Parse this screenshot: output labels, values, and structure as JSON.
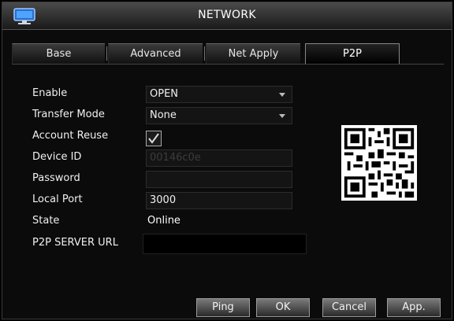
{
  "window": {
    "title": "NETWORK",
    "app_icon": "monitor-icon"
  },
  "tabs": [
    {
      "label": "Base",
      "active": false
    },
    {
      "label": "Advanced",
      "active": false
    },
    {
      "label": "Net Apply",
      "active": false
    },
    {
      "label": "P2P",
      "active": true
    }
  ],
  "form": {
    "enable": {
      "label": "Enable",
      "value": "OPEN"
    },
    "transfer_mode": {
      "label": "Transfer Mode",
      "value": "None"
    },
    "account_reuse": {
      "label": "Account Reuse",
      "checked": true
    },
    "device_id": {
      "label": "Device ID",
      "value": "00146c0e"
    },
    "password": {
      "label": "Password",
      "value": ""
    },
    "local_port": {
      "label": "Local Port",
      "value": "3000"
    },
    "state": {
      "label": "State",
      "value": "Online"
    },
    "p2p_server_url": {
      "label": "P2P SERVER URL",
      "value": ""
    }
  },
  "qr": {
    "icon": "qr-code-icon"
  },
  "buttons": {
    "ping": "Ping",
    "ok": "OK",
    "cancel": "Cancel",
    "apply": "App."
  }
}
